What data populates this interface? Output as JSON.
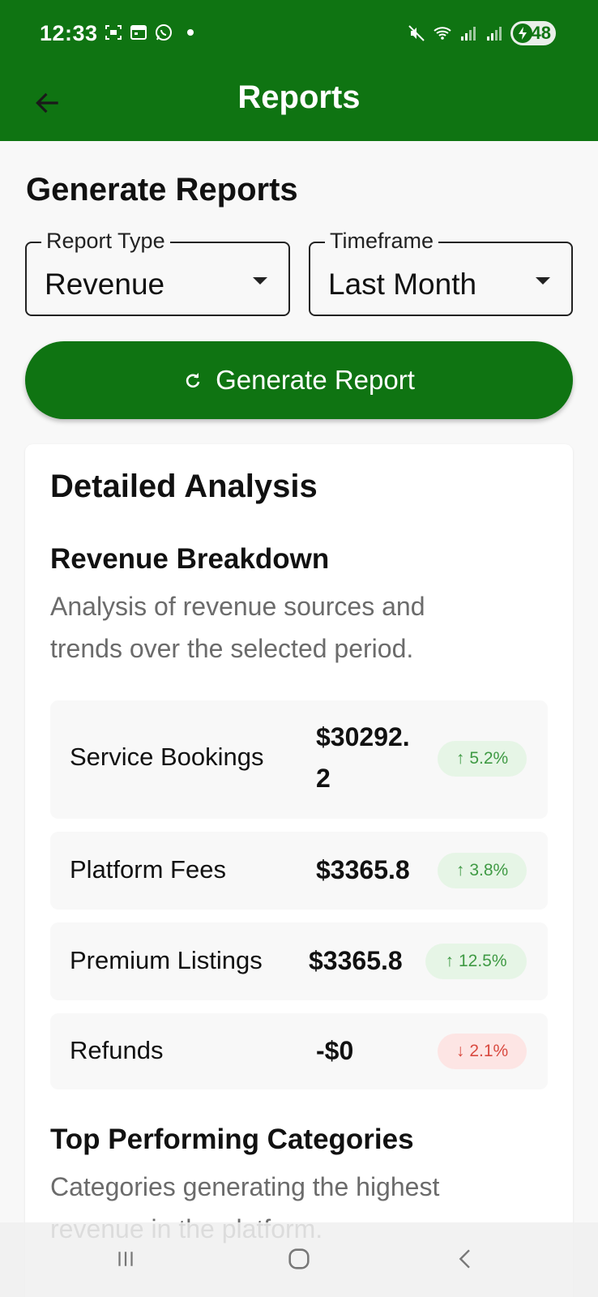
{
  "status_bar": {
    "time": "12:33",
    "battery": "48",
    "icons": [
      "screenshot-icon",
      "calendar-icon",
      "whatsapp-icon",
      "mute-icon",
      "wifi-icon",
      "signal-icon",
      "signal-icon",
      "battery-charging-icon"
    ]
  },
  "app_bar": {
    "title": "Reports"
  },
  "generate": {
    "title": "Generate Reports",
    "report_type": {
      "label": "Report Type",
      "value": "Revenue"
    },
    "timeframe": {
      "label": "Timeframe",
      "value": "Last Month"
    },
    "button_label": "Generate Report"
  },
  "analysis": {
    "title": "Detailed Analysis",
    "revenue": {
      "title": "Revenue Breakdown",
      "description": "Analysis of revenue sources and trends over the selected period.",
      "rows": [
        {
          "label": "Service Bookings",
          "value_line1": "$30292.",
          "value_line2": "2",
          "change": "5.2%",
          "trend": "up"
        },
        {
          "label": "Platform Fees",
          "value": "$3365.8",
          "change": "3.8%",
          "trend": "up"
        },
        {
          "label": "Premium Listings",
          "value": "$3365.8",
          "change": "12.5%",
          "trend": "up"
        },
        {
          "label": "Refunds",
          "value": "-$0",
          "change": "2.1%",
          "trend": "down"
        }
      ]
    },
    "categories": {
      "title": "Top Performing Categories",
      "description": "Categories generating the highest revenue in the platform."
    }
  },
  "colors": {
    "primary": "#0f7412",
    "up": "#3f9a44",
    "down": "#d94a40"
  }
}
